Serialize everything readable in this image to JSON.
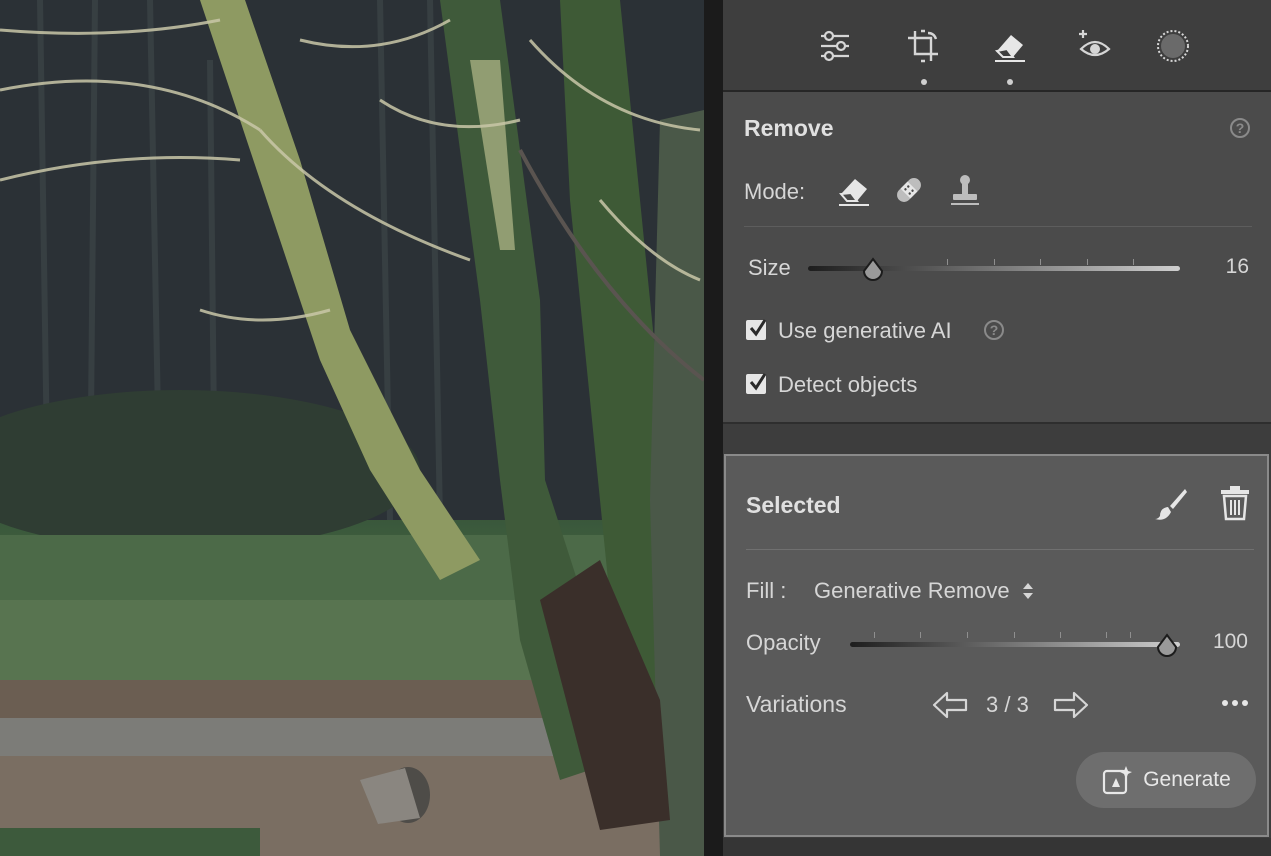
{
  "toolbar": {
    "tools": [
      {
        "name": "edit-sliders",
        "active": false
      },
      {
        "name": "crop",
        "active": false
      },
      {
        "name": "remove",
        "active": true
      },
      {
        "name": "red-eye",
        "active": false
      },
      {
        "name": "masking",
        "active": false
      }
    ]
  },
  "remove": {
    "title": "Remove",
    "mode_label": "Mode:",
    "size_label": "Size",
    "size_value": "16",
    "use_ai_label": "Use generative AI",
    "use_ai_checked": true,
    "detect_label": "Detect objects",
    "detect_checked": true
  },
  "selected": {
    "title": "Selected",
    "fill_label": "Fill :",
    "fill_value": "Generative Remove",
    "opacity_label": "Opacity",
    "opacity_value": "100",
    "variations_label": "Variations",
    "variations_value": "3 / 3",
    "generate_label": "Generate"
  },
  "colors": {
    "panel_bg": "#4b4b4b",
    "selected_bg": "#5a5a5a",
    "text": "#d6d6d6"
  }
}
